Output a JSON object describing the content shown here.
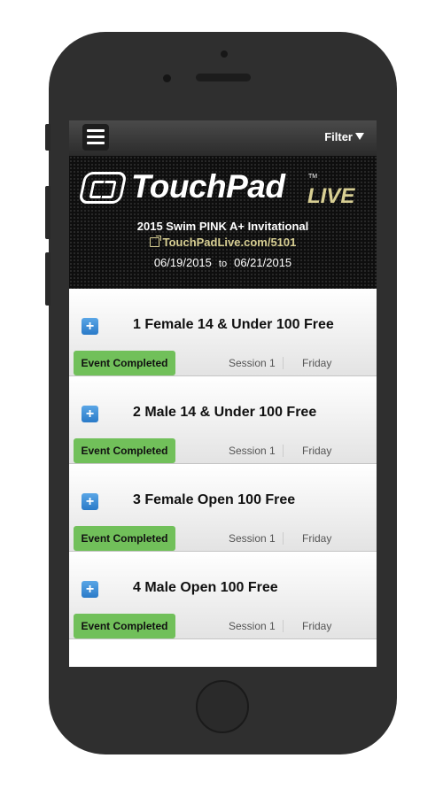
{
  "navbar": {
    "menu_icon": "hamburger-icon",
    "filter_label": "Filter",
    "filter_icon": "funnel-icon"
  },
  "banner": {
    "logo_text": "TouchPad",
    "logo_live": "LIVE",
    "logo_tm": "TM",
    "meet_name": "2015 Swim PINK A+ Invitational",
    "meet_link": "TouchPadLive.com/5101",
    "start_date": "06/19/2015",
    "date_separator": "to",
    "end_date": "06/21/2015"
  },
  "events": [
    {
      "title": "1 Female 14 & Under 100 Free",
      "status": "Event Completed",
      "session": "Session 1",
      "day": "Friday"
    },
    {
      "title": "2 Male 14 & Under 100 Free",
      "status": "Event Completed",
      "session": "Session 1",
      "day": "Friday"
    },
    {
      "title": "3 Female Open 100 Free",
      "status": "Event Completed",
      "session": "Session 1",
      "day": "Friday"
    },
    {
      "title": "4 Male Open 100 Free",
      "status": "Event Completed",
      "session": "Session 1",
      "day": "Friday"
    }
  ],
  "expand_label": "+",
  "colors": {
    "status_green": "#71c05a",
    "expand_blue": "#2a7ac8",
    "accent_gold": "#d8cf93"
  }
}
